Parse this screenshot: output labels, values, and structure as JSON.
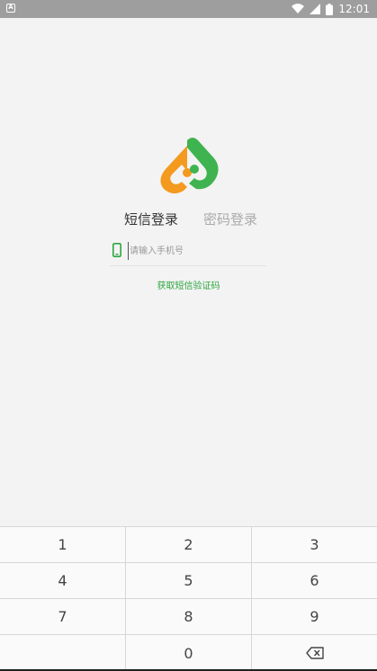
{
  "status_bar": {
    "time": "12:01",
    "notification_icon": "a-notification-icon"
  },
  "login": {
    "tab_sms": "短信登录",
    "tab_password": "密码登录",
    "phone_placeholder": "请输入手机号",
    "phone_value": "",
    "get_code": "获取短信验证码"
  },
  "keypad": {
    "k1": "1",
    "k2": "2",
    "k3": "3",
    "k4": "4",
    "k5": "5",
    "k6": "6",
    "k7": "7",
    "k8": "8",
    "k9": "9",
    "k0": "0"
  },
  "colors": {
    "accent_green": "#2ea640",
    "logo_orange": "#f39a1f",
    "logo_green": "#3fb34f"
  }
}
